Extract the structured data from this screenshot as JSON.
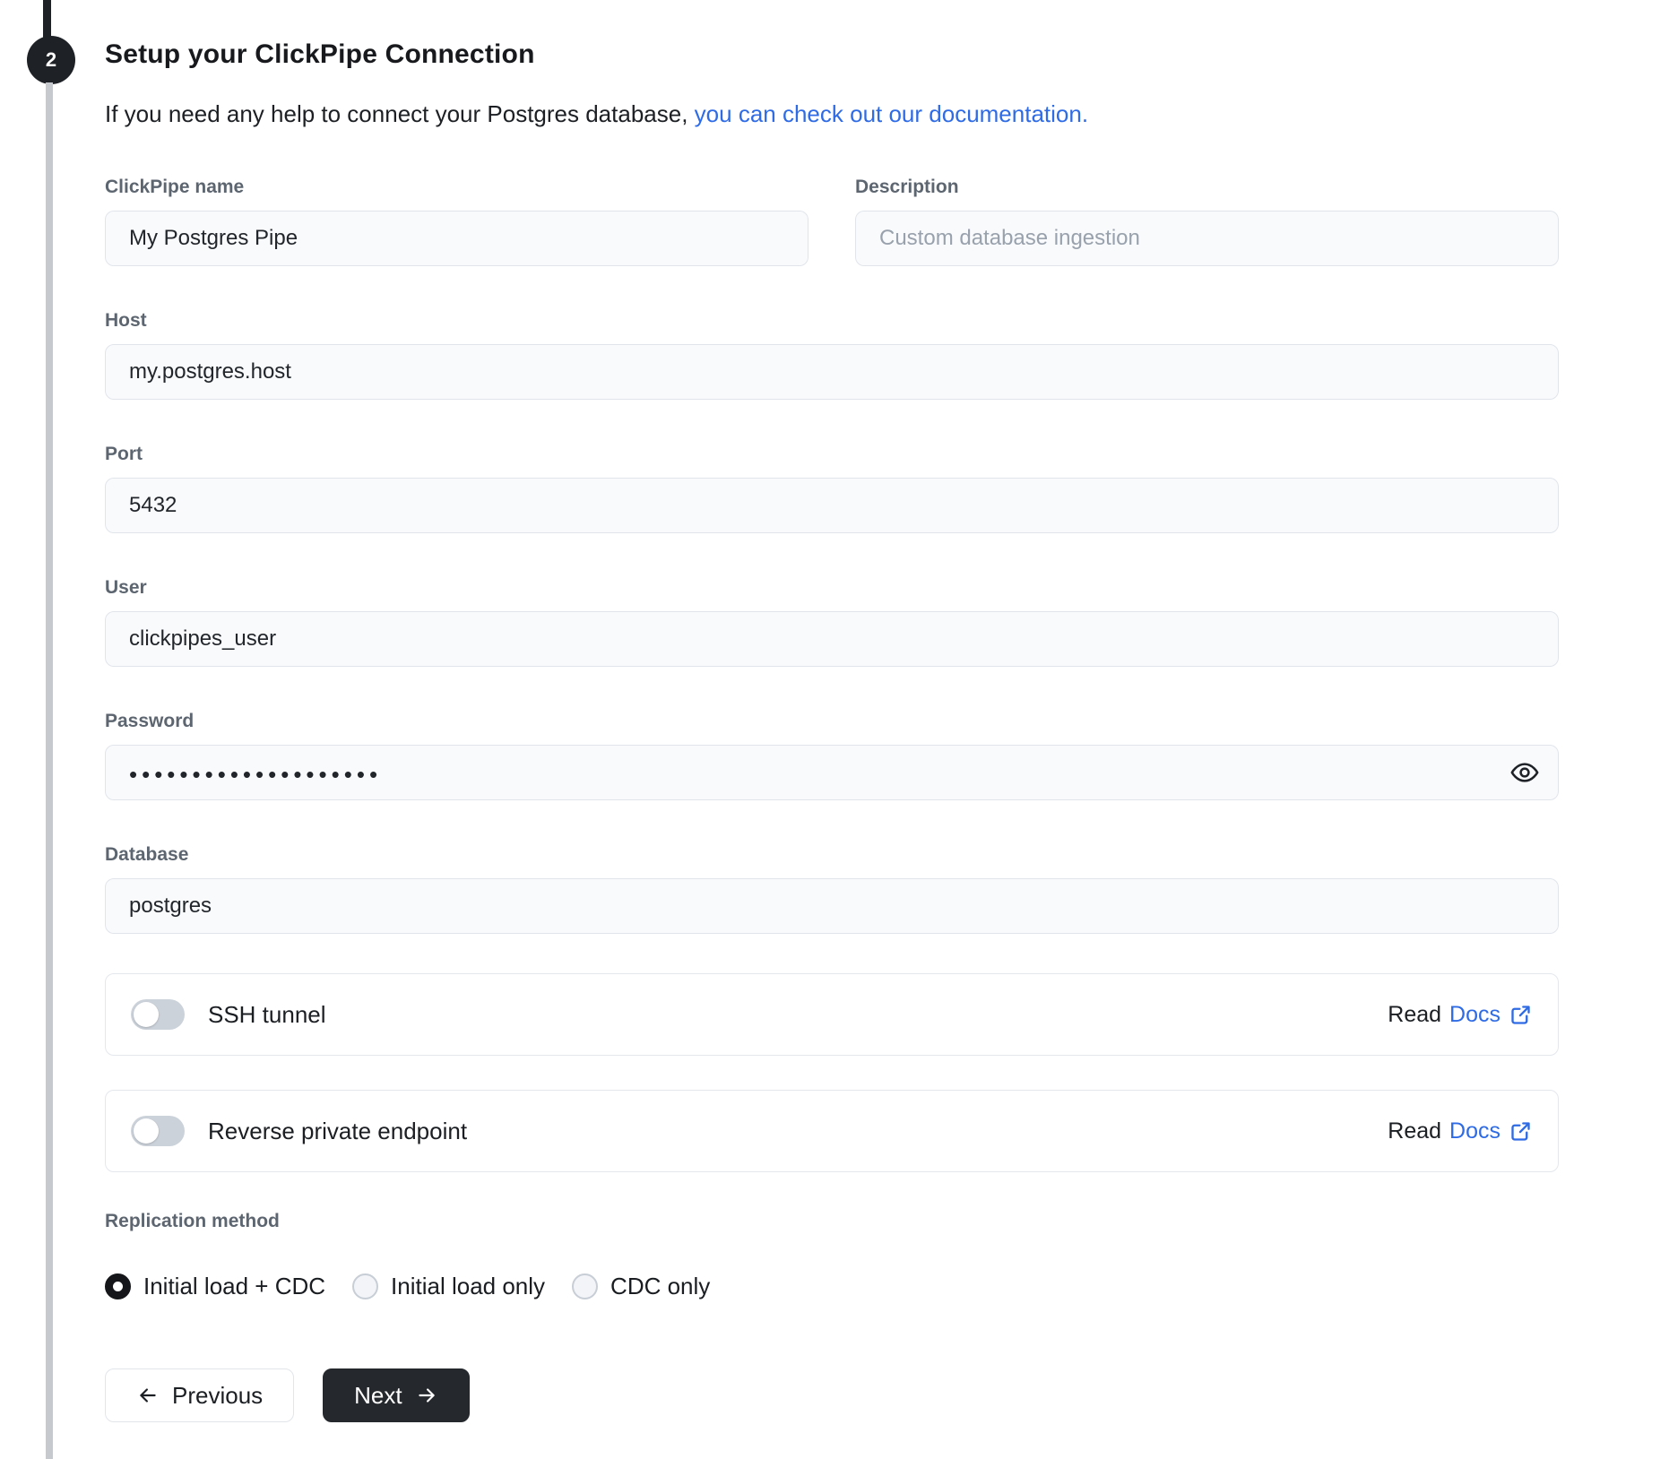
{
  "stepper": {
    "step_number": "2"
  },
  "header": {
    "title": "Setup your ClickPipe Connection",
    "subtitle_text": "If you need any help to connect your Postgres database,",
    "subtitle_link": "you can check out our documentation."
  },
  "form": {
    "clickpipe_name": {
      "label": "ClickPipe name",
      "value": "My Postgres Pipe"
    },
    "description": {
      "label": "Description",
      "placeholder": "Custom database ingestion"
    },
    "host": {
      "label": "Host",
      "value": "my.postgres.host"
    },
    "port": {
      "label": "Port",
      "value": "5432"
    },
    "user": {
      "label": "User",
      "value": "clickpipes_user"
    },
    "password": {
      "label": "Password",
      "value": "••••••••••••••••••••"
    },
    "database": {
      "label": "Database",
      "value": "postgres"
    }
  },
  "toggles": [
    {
      "label": "SSH tunnel",
      "read_label": "Read",
      "docs_label": "Docs",
      "enabled": false
    },
    {
      "label": "Reverse private endpoint",
      "read_label": "Read",
      "docs_label": "Docs",
      "enabled": false
    }
  ],
  "replication": {
    "label": "Replication method",
    "options": [
      {
        "label": "Initial load + CDC",
        "selected": true
      },
      {
        "label": "Initial load only",
        "selected": false
      },
      {
        "label": "CDC only",
        "selected": false
      }
    ]
  },
  "actions": {
    "previous_label": "Previous",
    "next_label": "Next"
  },
  "colors": {
    "link_blue": "#2e6be5",
    "step_dark": "#1e2125",
    "rail_gray": "#c6c9cd",
    "next_button_bg": "#25282c"
  }
}
